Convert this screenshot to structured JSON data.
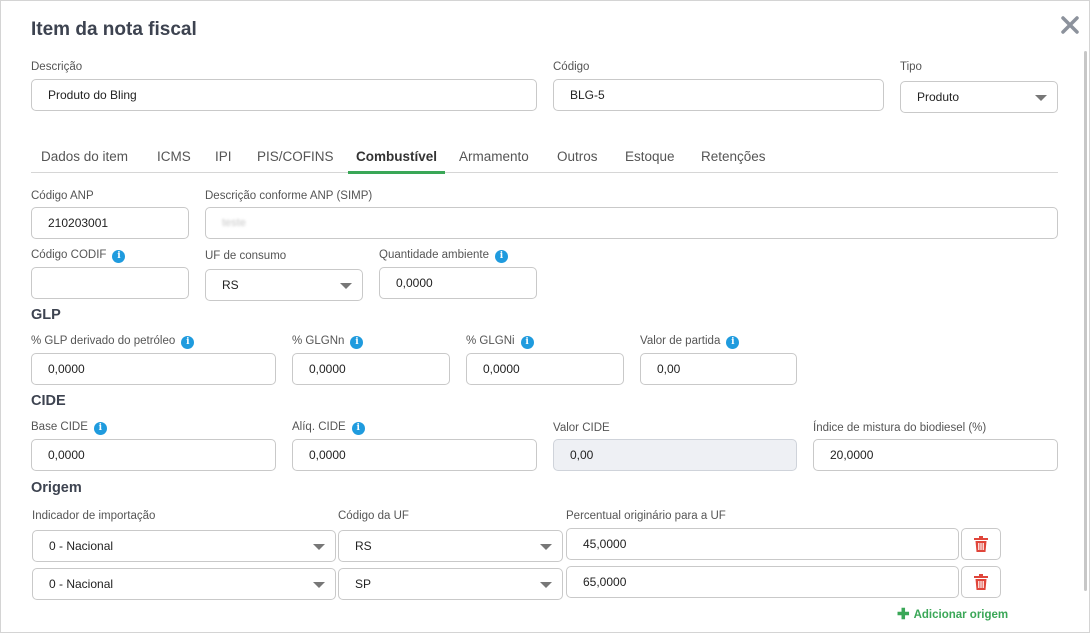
{
  "modal": {
    "title": "Item da nota fiscal",
    "close_icon": "close-icon"
  },
  "header_fields": {
    "descricao": {
      "label": "Descrição",
      "value": "Produto do Bling"
    },
    "codigo": {
      "label": "Código",
      "value": "BLG-5"
    },
    "tipo": {
      "label": "Tipo",
      "value": "Produto"
    }
  },
  "tabs": [
    {
      "label": "Dados do item",
      "active": false
    },
    {
      "label": "ICMS",
      "active": false
    },
    {
      "label": "IPI",
      "active": false
    },
    {
      "label": "PIS/COFINS",
      "active": false
    },
    {
      "label": "Combustível",
      "active": true
    },
    {
      "label": "Armamento",
      "active": false
    },
    {
      "label": "Outros",
      "active": false
    },
    {
      "label": "Estoque",
      "active": false
    },
    {
      "label": "Retenções",
      "active": false
    }
  ],
  "combustivel": {
    "codigo_anp": {
      "label": "Código ANP",
      "value": "210203001"
    },
    "descricao_anp": {
      "label": "Descrição conforme ANP (SIMP)",
      "value": "teste"
    },
    "codigo_codif": {
      "label": "Código CODIF",
      "value": ""
    },
    "uf_consumo": {
      "label": "UF de consumo",
      "value": "RS"
    },
    "quantidade_ambiente": {
      "label": "Quantidade ambiente",
      "value": "0,0000"
    }
  },
  "glp": {
    "title": "GLP",
    "glp_petroleo": {
      "label": "% GLP derivado do petróleo",
      "value": "0,0000"
    },
    "glgnn": {
      "label": "% GLGNn",
      "value": "0,0000"
    },
    "glgni": {
      "label": "% GLGNi",
      "value": "0,0000"
    },
    "valor_partida": {
      "label": "Valor de partida",
      "value": "0,00"
    }
  },
  "cide": {
    "title": "CIDE",
    "base": {
      "label": "Base CIDE",
      "value": "0,0000"
    },
    "aliq": {
      "label": "Alíq. CIDE",
      "value": "0,0000"
    },
    "valor": {
      "label": "Valor CIDE",
      "value": "0,00"
    },
    "indice_biodiesel": {
      "label": "Índice de mistura do biodiesel (%)",
      "value": "20,0000"
    }
  },
  "origem": {
    "title": "Origem",
    "col_indicador": "Indicador de importação",
    "col_uf": "Código da UF",
    "col_percentual": "Percentual originário para a UF",
    "rows": [
      {
        "indicador": "0 - Nacional",
        "uf": "RS",
        "percentual": "45,0000"
      },
      {
        "indicador": "0 - Nacional",
        "uf": "SP",
        "percentual": "65,0000"
      }
    ],
    "add_label": "Adicionar origem"
  },
  "colors": {
    "accent": "#3aa757",
    "info": "#1f9bde",
    "danger": "#e0453a",
    "title": "#3d4350"
  }
}
